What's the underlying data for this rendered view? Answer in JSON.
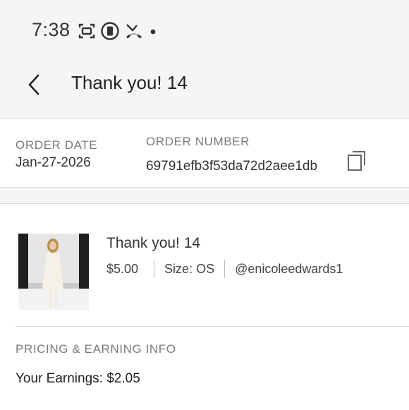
{
  "status_bar": {
    "time": "7:38",
    "icons": [
      "screenshot-icon",
      "sim-icon",
      "missed-call-icon",
      "notification-dot-icon"
    ]
  },
  "header": {
    "title": "Thank you! 14",
    "back_icon": "chevron-left-icon"
  },
  "order": {
    "date_label": "ORDER DATE",
    "date_value": "Jan-27-2026",
    "number_label": "ORDER NUMBER",
    "number_value": "69791efb3f53da72d2aee1db",
    "copy_icon": "copy-icon"
  },
  "product": {
    "title": "Thank you! 14",
    "price": "$5.00",
    "size": "Size: OS",
    "seller": "@enicoleedwards1"
  },
  "pricing": {
    "section_label": "PRICING & EARNING INFO",
    "earnings": "Your Earnings: $2.05"
  }
}
